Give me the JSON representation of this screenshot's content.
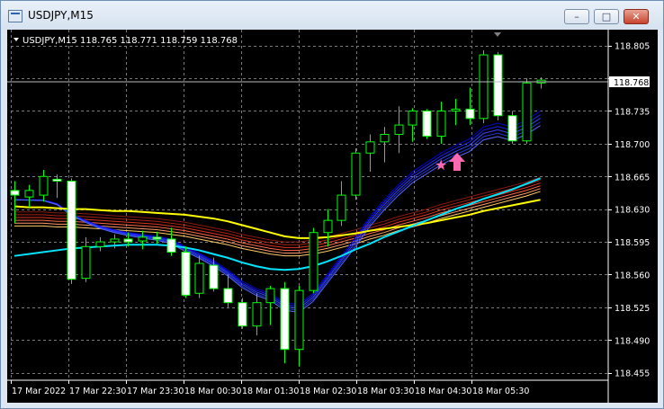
{
  "window": {
    "title": "USDJPY,M15",
    "minimize_label": "–",
    "maximize_label": "□",
    "close_label": "✕",
    "icons": [
      "chart-window-icon",
      "minimize-icon",
      "maximize-icon",
      "close-icon"
    ]
  },
  "chart": {
    "header": "USDJPY,M15",
    "ohlc_text": "118.765 118.771 118.759 118.768",
    "current_price": "118.768",
    "colors": {
      "background": "#000000",
      "grid": "#808080",
      "bull_candle": "#00ff00",
      "bear_body": "#ffffff",
      "axis_text": "#ffffff",
      "price_tag_bg": "#ffffff",
      "signal": "#ff69b4"
    },
    "signal_markers": [
      "star-marker",
      "up-arrow-marker"
    ]
  },
  "chart_data": {
    "type": "candlestick",
    "symbol": "USDJPY",
    "timeframe": "M15",
    "y_ticks": [
      118.805,
      118.77,
      118.735,
      118.7,
      118.665,
      118.63,
      118.595,
      118.56,
      118.525,
      118.49,
      118.455
    ],
    "y_tick_labels": [
      "118.805",
      "118.735",
      "118.700",
      "118.665",
      "118.630",
      "118.595",
      "118.560",
      "118.525",
      "118.490",
      "118.455"
    ],
    "x_labels": [
      "17 Mar 2022",
      "17 Mar 22:30",
      "17 Mar 23:30",
      "18 Mar 00:30",
      "18 Mar 01:30",
      "18 Mar 02:30",
      "18 Mar 03:30",
      "18 Mar 04:30",
      "18 Mar 05:30"
    ],
    "ylim": [
      118.447,
      118.822
    ],
    "candles": [
      {
        "o": 118.65,
        "h": 118.66,
        "l": 118.615,
        "c": 118.645
      },
      {
        "o": 118.643,
        "h": 118.656,
        "l": 118.632,
        "c": 118.65
      },
      {
        "o": 118.645,
        "h": 118.672,
        "l": 118.638,
        "c": 118.665
      },
      {
        "o": 118.662,
        "h": 118.667,
        "l": 118.642,
        "c": 118.66
      },
      {
        "o": 118.66,
        "h": 118.663,
        "l": 118.55,
        "c": 118.555
      },
      {
        "o": 118.556,
        "h": 118.6,
        "l": 118.552,
        "c": 118.59
      },
      {
        "o": 118.59,
        "h": 118.6,
        "l": 118.585,
        "c": 118.595
      },
      {
        "o": 118.595,
        "h": 118.603,
        "l": 118.588,
        "c": 118.598
      },
      {
        "o": 118.598,
        "h": 118.605,
        "l": 118.59,
        "c": 118.595
      },
      {
        "o": 118.596,
        "h": 118.607,
        "l": 118.587,
        "c": 118.6
      },
      {
        "o": 118.6,
        "h": 118.606,
        "l": 118.593,
        "c": 118.598
      },
      {
        "o": 118.598,
        "h": 118.61,
        "l": 118.58,
        "c": 118.584
      },
      {
        "o": 118.584,
        "h": 118.59,
        "l": 118.535,
        "c": 118.538
      },
      {
        "o": 118.54,
        "h": 118.58,
        "l": 118.535,
        "c": 118.572
      },
      {
        "o": 118.57,
        "h": 118.578,
        "l": 118.542,
        "c": 118.545
      },
      {
        "o": 118.545,
        "h": 118.56,
        "l": 118.525,
        "c": 118.53
      },
      {
        "o": 118.53,
        "h": 118.535,
        "l": 118.502,
        "c": 118.505
      },
      {
        "o": 118.505,
        "h": 118.54,
        "l": 118.495,
        "c": 118.53
      },
      {
        "o": 118.53,
        "h": 118.548,
        "l": 118.506,
        "c": 118.545
      },
      {
        "o": 118.545,
        "h": 118.552,
        "l": 118.465,
        "c": 118.48
      },
      {
        "o": 118.48,
        "h": 118.548,
        "l": 118.462,
        "c": 118.543
      },
      {
        "o": 118.543,
        "h": 118.61,
        "l": 118.54,
        "c": 118.605
      },
      {
        "o": 118.605,
        "h": 118.63,
        "l": 118.59,
        "c": 118.618
      },
      {
        "o": 118.618,
        "h": 118.66,
        "l": 118.612,
        "c": 118.645
      },
      {
        "o": 118.645,
        "h": 118.695,
        "l": 118.64,
        "c": 118.69
      },
      {
        "o": 118.69,
        "h": 118.71,
        "l": 118.67,
        "c": 118.702
      },
      {
        "o": 118.702,
        "h": 118.718,
        "l": 118.68,
        "c": 118.71
      },
      {
        "o": 118.71,
        "h": 118.74,
        "l": 118.69,
        "c": 118.72
      },
      {
        "o": 118.72,
        "h": 118.738,
        "l": 118.702,
        "c": 118.735
      },
      {
        "o": 118.735,
        "h": 118.737,
        "l": 118.705,
        "c": 118.708
      },
      {
        "o": 118.708,
        "h": 118.745,
        "l": 118.7,
        "c": 118.735
      },
      {
        "o": 118.735,
        "h": 118.748,
        "l": 118.72,
        "c": 118.737
      },
      {
        "o": 118.737,
        "h": 118.76,
        "l": 118.72,
        "c": 118.727
      },
      {
        "o": 118.727,
        "h": 118.8,
        "l": 118.722,
        "c": 118.795
      },
      {
        "o": 118.795,
        "h": 118.798,
        "l": 118.725,
        "c": 118.73
      },
      {
        "o": 118.73,
        "h": 118.735,
        "l": 118.7,
        "c": 118.703
      },
      {
        "o": 118.703,
        "h": 118.77,
        "l": 118.7,
        "c": 118.765
      },
      {
        "o": 118.765,
        "h": 118.771,
        "l": 118.759,
        "c": 118.768
      }
    ],
    "series": [
      {
        "name": "",
        "color": "#ffff00",
        "values": [
          118.633,
          118.632,
          118.632,
          118.631,
          118.63,
          118.63,
          118.629,
          118.628,
          118.628,
          118.627,
          118.626,
          118.625,
          118.624,
          118.622,
          118.62,
          118.617,
          118.613,
          118.609,
          118.605,
          118.601,
          118.599,
          118.599,
          118.6,
          118.602,
          118.604,
          118.607,
          118.609,
          118.611,
          118.613,
          118.615,
          118.618,
          118.621,
          118.624,
          118.628,
          118.631,
          118.634,
          118.637,
          118.64
        ]
      },
      {
        "name": "",
        "color": "#00e5ff",
        "values": [
          118.58,
          118.582,
          118.584,
          118.586,
          118.588,
          118.589,
          118.59,
          118.591,
          118.592,
          118.592,
          118.592,
          118.591,
          118.589,
          118.586,
          118.582,
          118.578,
          118.573,
          118.569,
          118.566,
          118.565,
          118.566,
          118.569,
          118.574,
          118.58,
          118.587,
          118.593,
          118.6,
          118.606,
          118.612,
          118.618,
          118.624,
          118.63,
          118.635,
          118.641,
          118.646,
          118.651,
          118.657,
          118.663
        ]
      },
      {
        "name": "",
        "color": "#cc2200",
        "values": [
          118.618,
          118.618,
          118.618,
          118.617,
          118.617,
          118.616,
          118.615,
          118.614,
          118.613,
          118.612,
          118.611,
          118.609,
          118.607,
          118.604,
          118.601,
          118.598,
          118.594,
          118.591,
          118.588,
          118.586,
          118.586,
          118.588,
          118.591,
          118.595,
          118.599,
          118.604,
          118.608,
          118.613,
          118.617,
          118.621,
          118.626,
          118.63,
          118.634,
          118.638,
          118.642,
          118.646,
          118.65,
          118.655
        ]
      },
      {
        "name": "",
        "color": "#1a3cff",
        "values": [
          118.64,
          118.64,
          118.64,
          118.636,
          118.625,
          118.618,
          118.612,
          118.608,
          118.605,
          118.603,
          118.601,
          118.598,
          118.59,
          118.583,
          118.575,
          118.565,
          118.553,
          118.545,
          118.54,
          118.53,
          118.528,
          118.54,
          118.56,
          118.58,
          118.6,
          118.622,
          118.64,
          118.656,
          118.67,
          118.68,
          118.69,
          118.698,
          118.705,
          118.718,
          118.722,
          118.718,
          118.725,
          118.735
        ]
      }
    ]
  }
}
